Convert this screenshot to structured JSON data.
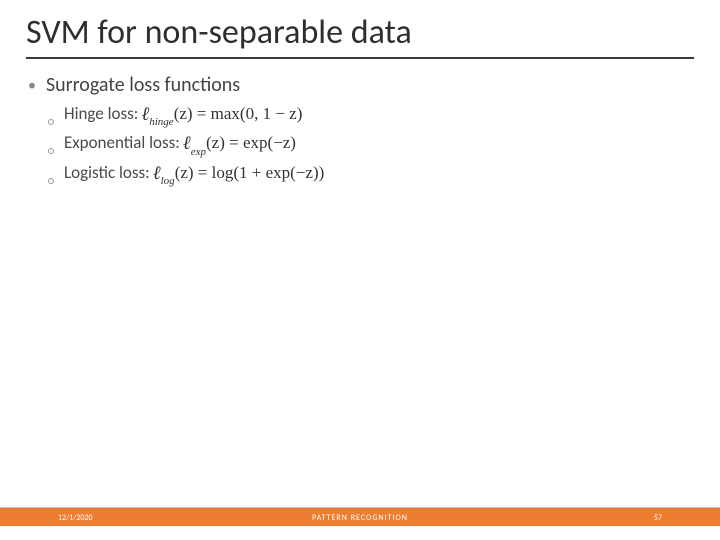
{
  "title": "SVM for non-separable data",
  "main_bullet": {
    "heading": "Surrogate loss functions"
  },
  "sub_bullets": [
    {
      "label": "Hinge loss:",
      "formula_symbol": "ℓ",
      "formula_sub": "hinge",
      "formula_arg": "(z) = max(0, 1 − z)"
    },
    {
      "label": "Exponential loss:",
      "formula_symbol": "ℓ",
      "formula_sub": "exp",
      "formula_arg": "(z) = exp(−z)"
    },
    {
      "label": "Logistic loss:",
      "formula_symbol": "ℓ",
      "formula_sub": "log",
      "formula_arg": "(z) = log(1 + exp(−z))"
    }
  ],
  "footer": {
    "date": "12/1/2020",
    "center": "PATTERN RECOGNITION",
    "page": "57"
  }
}
